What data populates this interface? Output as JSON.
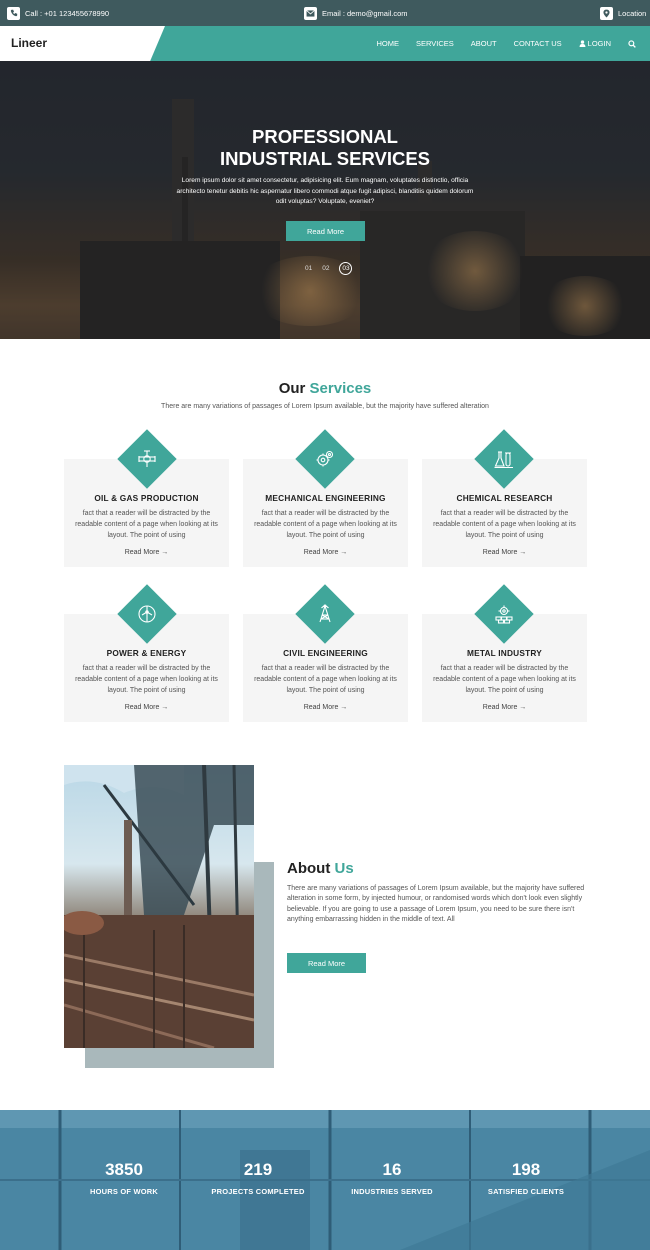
{
  "topbar": {
    "call": "Call : +01 123455678990",
    "email": "Email : demo@gmail.com",
    "location": "Location"
  },
  "header": {
    "logo": "Lineer",
    "nav": [
      "HOME",
      "SERVICES",
      "ABOUT",
      "CONTACT US",
      "LOGIN"
    ]
  },
  "hero": {
    "title_line1": "PROFESSIONAL",
    "title_line2": "INDUSTRIAL SERVICES",
    "text": "Lorem ipsum dolor sit amet consectetur, adipisicing elit. Eum magnam, voluptates distinctio, officia architecto tenetur debitis hic aspernatur libero commodi atque fugit adipisci, blanditiis quidem dolorum odit voluptas? Voluptate, eveniet?",
    "button": "Read More",
    "slides": [
      "01",
      "02",
      "03"
    ]
  },
  "services": {
    "title_main": "Our",
    "title_accent": "Services",
    "subtitle": "There are many variations of passages of Lorem Ipsum available, but the majority have suffered alteration",
    "items": [
      {
        "title": "OIL & GAS PRODUCTION",
        "text": "fact that a reader will be distracted by the readable content of a page when looking at its layout. The point of using",
        "more": "Read More →",
        "icon": "oil-gas-icon"
      },
      {
        "title": "MECHANICAL ENGINEERING",
        "text": "fact that a reader will be distracted by the readable content of a page when looking at its layout. The point of using",
        "more": "Read More →",
        "icon": "gears-icon"
      },
      {
        "title": "CHEMICAL RESEARCH",
        "text": "fact that a reader will be distracted by the readable content of a page when looking at its layout. The point of using",
        "more": "Read More →",
        "icon": "flask-icon"
      },
      {
        "title": "POWER & ENERGY",
        "text": "fact that a reader will be distracted by the readable content of a page when looking at its layout. The point of using",
        "more": "Read More →",
        "icon": "wind-turbine-icon"
      },
      {
        "title": "CIVIL ENGINEERING",
        "text": "fact that a reader will be distracted by the readable content of a page when looking at its layout. The point of using",
        "more": "Read More →",
        "icon": "tower-icon"
      },
      {
        "title": "METAL INDUSTRY",
        "text": "fact that a reader will be distracted by the readable content of a page when looking at its layout. The point of using",
        "more": "Read More →",
        "icon": "metal-industry-icon"
      }
    ]
  },
  "about": {
    "title_main": "About",
    "title_accent": "Us",
    "text": "There are many variations of passages of Lorem Ipsum available, but the majority have suffered alteration in some form, by injected humour, or randomised words which don't look even slightly believable. If you are going to use a passage of Lorem Ipsum, you need to be sure there isn't anything embarrassing hidden in the middle of text. All",
    "button": "Read More"
  },
  "counters": [
    {
      "num": "3850",
      "label": "HOURS OF WORK"
    },
    {
      "num": "219",
      "label": "PROJECTS COMPLETED"
    },
    {
      "num": "16",
      "label": "INDUSTRIES SERVED"
    },
    {
      "num": "198",
      "label": "SATISFIED CLIENTS"
    }
  ],
  "colors": {
    "accent": "#40a69a",
    "topbar": "#3f5a5e",
    "card_bg": "#f5f5f5"
  }
}
